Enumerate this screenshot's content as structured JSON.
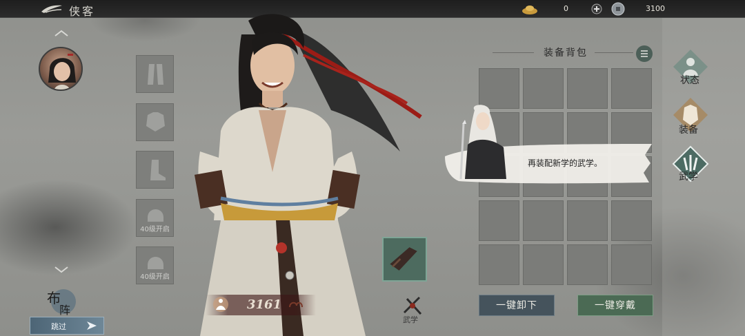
{
  "header": {
    "title": "侠客",
    "gold_value": "0",
    "coin_value": "3100"
  },
  "left_slots": [
    {
      "name": "weapon-slot",
      "locked_text": ""
    },
    {
      "name": "armor-slot",
      "locked_text": ""
    },
    {
      "name": "boots-slot",
      "locked_text": ""
    },
    {
      "name": "locked-slot-1",
      "locked_text": "40级开启"
    },
    {
      "name": "locked-slot-2",
      "locked_text": "40级开启"
    }
  ],
  "hero": {
    "power": "3161"
  },
  "martial": {
    "label": "武学"
  },
  "backpack": {
    "title": "装备背包",
    "unequip_all": "一键卸下",
    "equip_all": "一键穿戴"
  },
  "dialog": {
    "text": "再装配新学的武学。"
  },
  "tabs": [
    {
      "label": "状态"
    },
    {
      "label": "装备"
    },
    {
      "label": "武学"
    }
  ],
  "bottom": {
    "formation_label": "布阵",
    "skip_label": "跳过"
  },
  "colors": {
    "equip_button": "#4b6a54",
    "unequip_button": "#45535c",
    "tab_active": "#4c6b63"
  }
}
